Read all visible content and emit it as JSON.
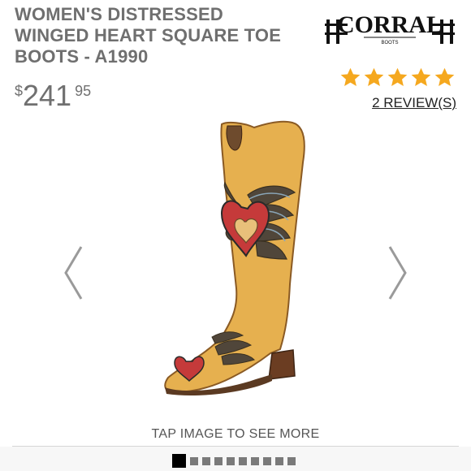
{
  "product": {
    "title_lines": [
      "WOMEN'S DISTRESSED",
      "WINGED HEART SQUARE TOE",
      "BOOTS - A1990"
    ],
    "price": {
      "currency": "$",
      "dollars": "241",
      "cents": "95"
    }
  },
  "brand": {
    "logo_text": "CORRAL",
    "logo_subtext": "BOOTS"
  },
  "rating": {
    "stars": 5,
    "max": 5,
    "star_color": "#f5a81f",
    "reviews_link": "2 REVIEW(S)"
  },
  "gallery": {
    "caption": "TAP IMAGE TO SEE MORE",
    "slide_count": 10,
    "active_index": 0,
    "prev_icon": "chevron-left-icon",
    "next_icon": "chevron-right-icon"
  }
}
